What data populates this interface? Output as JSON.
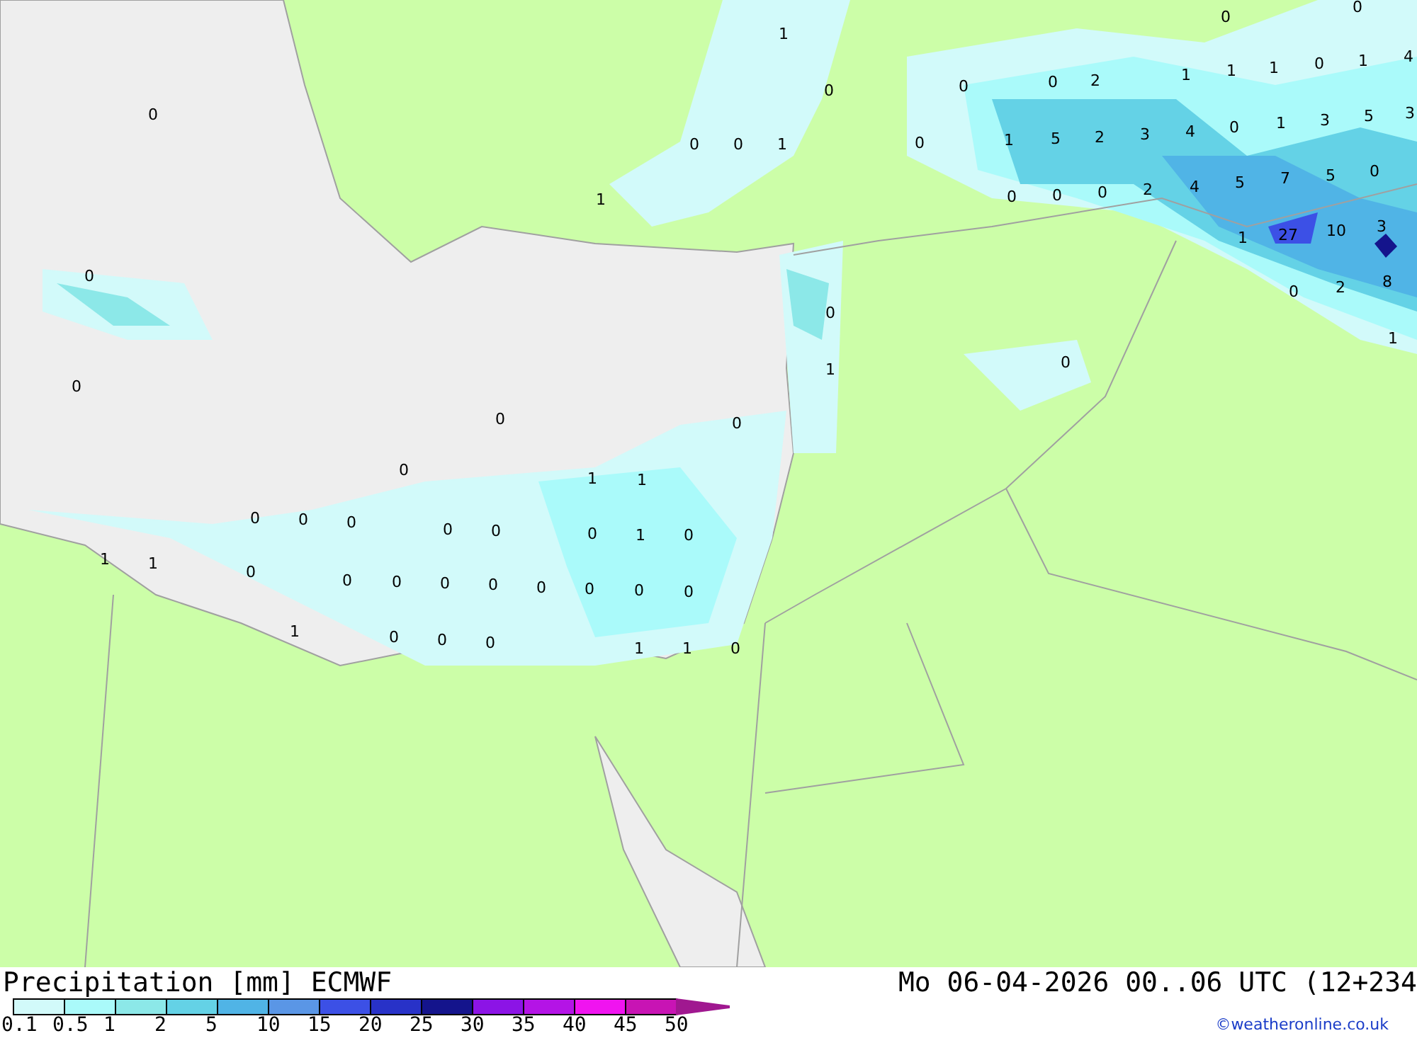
{
  "map_values": [
    "1",
    "0",
    "0",
    "0",
    "0",
    "0",
    "0",
    "2",
    "1",
    "1",
    "1",
    "0",
    "1",
    "4",
    "0",
    "0",
    "1",
    "0",
    "1",
    "5",
    "2",
    "3",
    "4",
    "0",
    "1",
    "3",
    "5",
    "3",
    "1",
    "0",
    "0",
    "0",
    "2",
    "4",
    "5",
    "7",
    "5",
    "0",
    "1",
    "27",
    "10",
    "3",
    "0",
    "0",
    "2",
    "8",
    "1",
    "0",
    "1",
    "0",
    "0",
    "0",
    "0",
    "0",
    "1",
    "1",
    "0",
    "0",
    "0",
    "0",
    "0",
    "0",
    "1",
    "0",
    "1",
    "1",
    "0",
    "0",
    "0",
    "0",
    "0",
    "0",
    "0",
    "0",
    "0",
    "1",
    "0",
    "0",
    "0",
    "1",
    "1",
    "0"
  ],
  "footer": {
    "title": "Precipitation [mm] ECMWF",
    "valid_time": "Mo 06-04-2026 00..06 UTC (12+234",
    "credit": "©weatheronline.co.uk"
  },
  "legend": {
    "bins": [
      {
        "color": "#d2fafa"
      },
      {
        "color": "#aafafa"
      },
      {
        "color": "#8ce8e8"
      },
      {
        "color": "#64d2e6"
      },
      {
        "color": "#50b4e6"
      },
      {
        "color": "#5a96e6"
      },
      {
        "color": "#3c50e6"
      },
      {
        "color": "#2832c8"
      },
      {
        "color": "#14148c"
      },
      {
        "color": "#8c14e6"
      },
      {
        "color": "#b414e6"
      },
      {
        "color": "#f014f0"
      },
      {
        "color": "#c814b4"
      }
    ],
    "labels": [
      "0.1",
      "0.5",
      "1",
      "2",
      "5",
      "10",
      "15",
      "20",
      "25",
      "30",
      "35",
      "40",
      "45",
      "50"
    ]
  }
}
